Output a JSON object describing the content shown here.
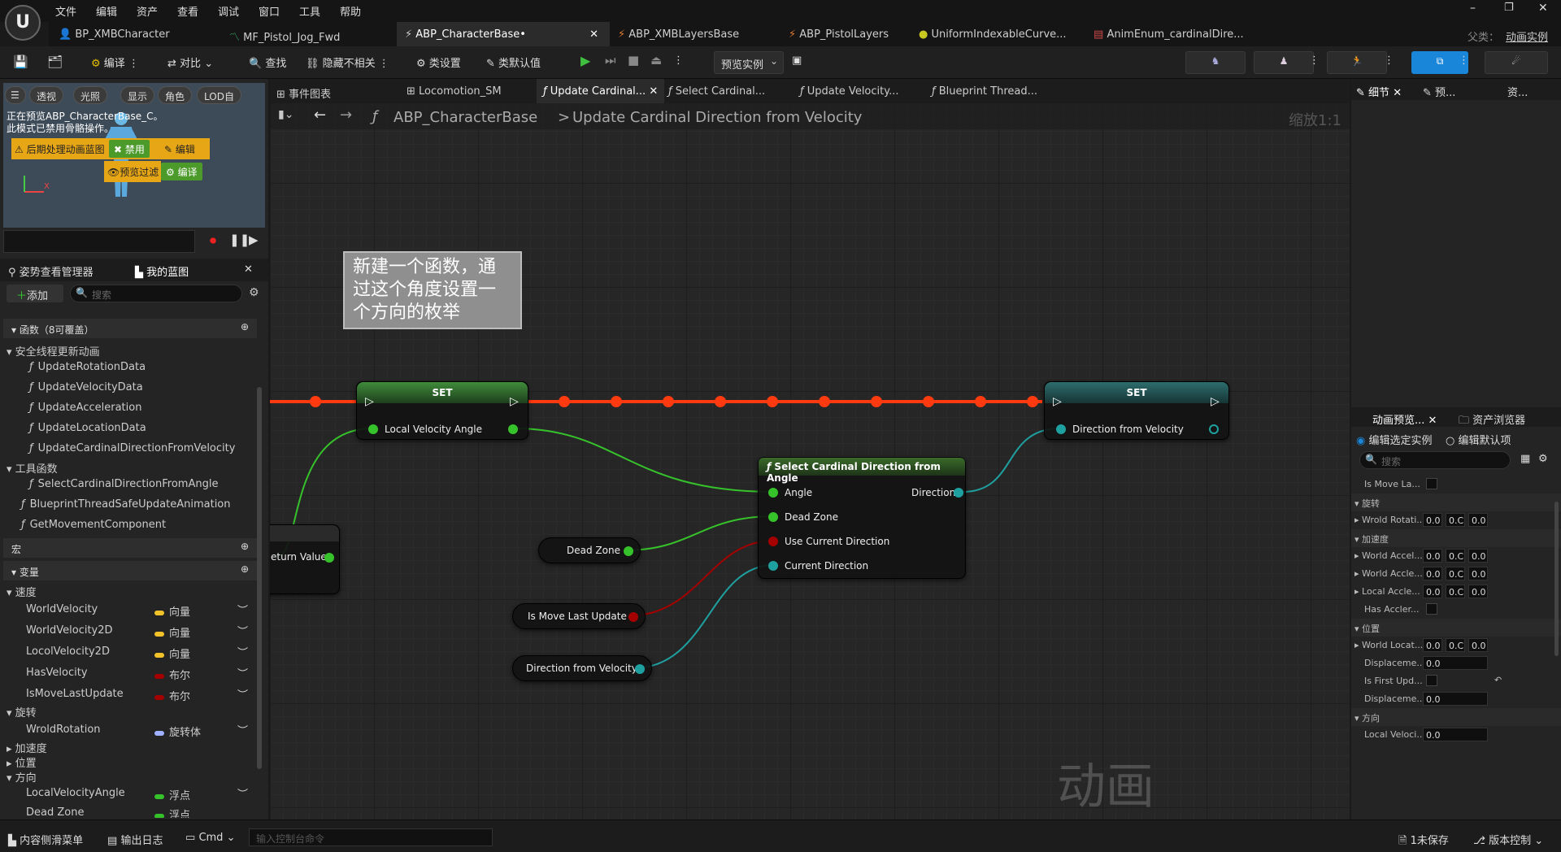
{
  "menu": [
    "文件",
    "编辑",
    "资产",
    "查看",
    "调试",
    "窗口",
    "工具",
    "帮助"
  ],
  "doc_tabs": [
    "BP_XMBCharacter",
    "MF_Pistol_Jog_Fwd",
    "ABP_CharacterBase•",
    "ABP_XMBLayersBase",
    "ABP_PistolLayers",
    "UniformIndexableCurve...",
    "AnimEnum_cardinalDire..."
  ],
  "top_right": {
    "label1": "父类：",
    "label2": "动画实例"
  },
  "toolbar": {
    "compile": "编译",
    "diff": "对比",
    "find": "查找",
    "hide": "隐藏不相关",
    "class_settings": "类设置",
    "class_defaults": "类默认值",
    "preview": "预览实例"
  },
  "viewport": {
    "chips": [
      "透视",
      "光照",
      "显示",
      "角色",
      "LOD自"
    ],
    "text": "正在预览ABP_CharacterBase_C。此模式已禁用骨骼操作。",
    "post_label": "后期处理动画蓝图",
    "disable": "禁用",
    "edit": "编辑",
    "preview_override": "预览过滤",
    "compile": "编译"
  },
  "left_tabs": {
    "pose": "姿势查看管理器",
    "blueprint": "我的蓝图"
  },
  "add_button": "添加",
  "search_placeholder": "搜索",
  "functions_header": "函数（8可覆盖）",
  "tree": {
    "group1": "安全线程更新动画",
    "items1": [
      "UpdateRotationData",
      "UpdateVelocityData",
      "UpdateAcceleration",
      "UpdateLocationData",
      "UpdateCardinalDirectionFromVelocity"
    ],
    "group2": "工具函数",
    "items2": [
      "SelectCardinalDirectionFromAngle",
      "BlueprintThreadSafeUpdateAnimation",
      "GetMovementComponent"
    ]
  },
  "macros_header": "宏",
  "vars_header": "变量",
  "vars": {
    "speed": "速度",
    "speed_items": [
      {
        "n": "WorldVelocity",
        "t": "向量",
        "c": "#f2c229"
      },
      {
        "n": "WorldVelocity2D",
        "t": "向量",
        "c": "#f2c229"
      },
      {
        "n": "LocolVelocity2D",
        "t": "向量",
        "c": "#f2c229"
      },
      {
        "n": "HasVelocity",
        "t": "布尔",
        "c": "#a50000"
      },
      {
        "n": "IsMoveLastUpdate",
        "t": "布尔",
        "c": "#a50000"
      }
    ],
    "rot": "旋转",
    "rot_items": [
      {
        "n": "WroldRotation",
        "t": "旋转体",
        "c": "#9fb0ff"
      }
    ],
    "accel": "加速度",
    "pos": "位置",
    "dir": "方向",
    "dir_items": [
      {
        "n": "LocalVelocityAngle",
        "t": "浮点",
        "c": "#36c22b"
      },
      {
        "n": "Dead Zone",
        "t": "浮点",
        "c": "#36c22b"
      }
    ]
  },
  "graph_tabs": [
    "事件图表",
    "Locomotion_SM",
    "Update Cardinal...",
    "Select Cardinal...",
    "Update Velocity...",
    "Blueprint Thread..."
  ],
  "breadcrumb": {
    "root": "ABP_CharacterBase",
    "sep": ">",
    "leaf": "Update Cardinal Direction from Velocity",
    "zoom": "缩放1:1"
  },
  "comment": "新建一个函数，通过这个角度设置一个方向的枚举",
  "nodes": {
    "set1_title": "SET",
    "set1_pin": "Local Velocity Angle",
    "set2_title": "SET",
    "set2_pin": "Direction from Velocity",
    "select_title": "Select Cardinal Direction from Angle",
    "select_pins": [
      "Angle",
      "Dead Zone",
      "Use Current Direction",
      "Current Direction"
    ],
    "select_out": "Direction",
    "return_value": "eturn Value",
    "get_dead_zone": "Dead Zone",
    "get_is_move": "Is Move Last Update",
    "get_direction": "Direction from Velocity"
  },
  "watermark": "动画",
  "right_tabs": {
    "details": "细节",
    "preview": "预...",
    "assets": "资..."
  },
  "right_bottom_tabs": {
    "anim_preview": "动画预览...",
    "asset_browser": "资产浏览器"
  },
  "radio": {
    "edit_instance": "编辑选定实例",
    "edit_defaults": "编辑默认项"
  },
  "props": {
    "is_move": "Is Move La...",
    "rot": "旋转",
    "world_rot": "Wrold Rotati...",
    "accel": "加速度",
    "world_accel1": "World Accel...",
    "world_accel2": "World Accle...",
    "local_accel": "Local Accle...",
    "has_accel": "Has Accler...",
    "pos": "位置",
    "world_loc": "World Locat...",
    "disp1": "Displaceme...",
    "first": "Is First Upd...",
    "disp2": "Displaceme...",
    "dir": "方向",
    "local_vel": "Local Veloci...",
    "v": "0.0",
    "vc": "0.C"
  },
  "status": {
    "drawer": "内容侧滑菜单",
    "output": "输出日志",
    "cmd": "Cmd",
    "console_placeholder": "输入控制台命令",
    "unsaved": "1未保存",
    "source": "版本控制"
  }
}
